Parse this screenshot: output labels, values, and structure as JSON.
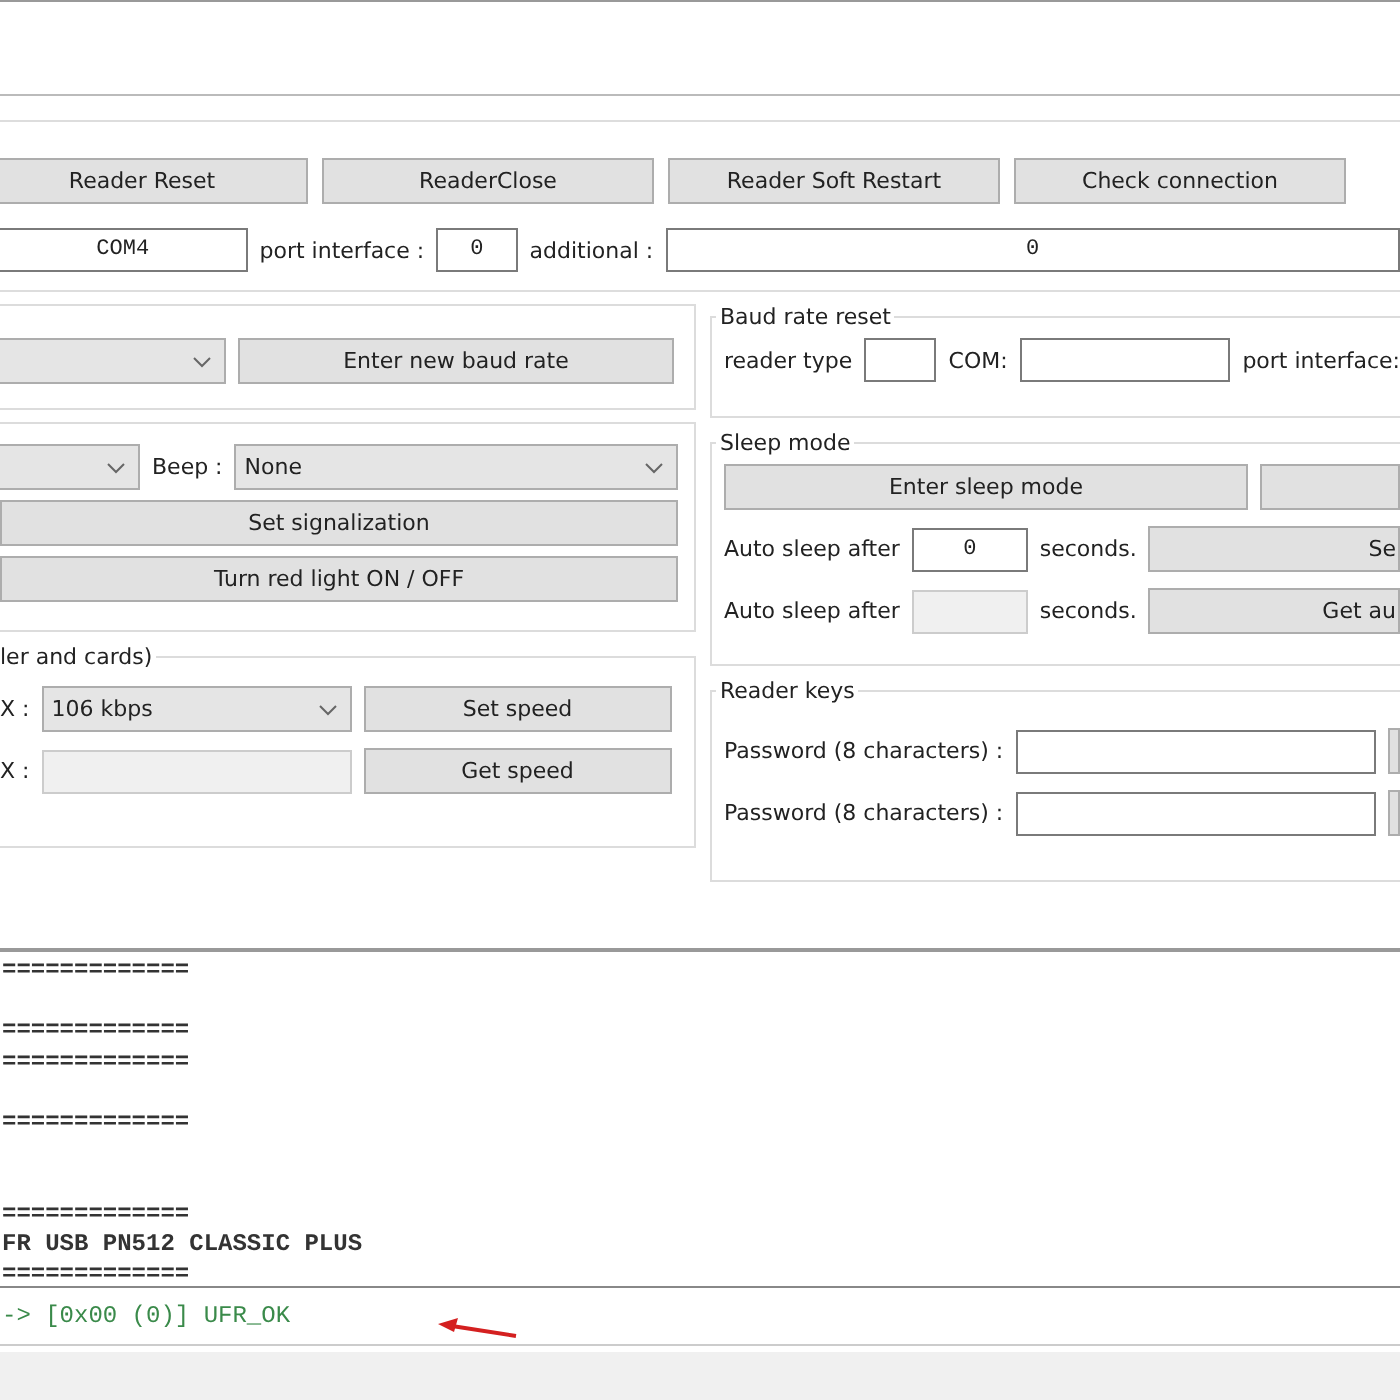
{
  "top_buttons": [
    "Reader Reset",
    "ReaderClose",
    "Reader Soft Restart",
    "Check connection"
  ],
  "connection": {
    "com": "COM4",
    "port_label": "port interface :",
    "port": "0",
    "additional_label": "additional :",
    "additional": "0"
  },
  "baud_panel": {
    "button": "Enter new baud rate"
  },
  "baud_rate_reset": {
    "title": "Baud rate reset",
    "reader_type_label": "reader type",
    "com_label": "COM:",
    "port_label": "port interface:"
  },
  "signalization": {
    "beep_label": "Beep :",
    "beep_value": "None",
    "buttons": [
      "Set signalization",
      "Turn red light ON / OFF"
    ]
  },
  "sleep_mode": {
    "title": "Sleep mode",
    "enter_button": "Enter sleep mode",
    "rows": [
      {
        "label": "Auto sleep after",
        "value": "0",
        "disabled": false,
        "unit": "seconds.",
        "button": "Se"
      },
      {
        "label": "Auto sleep after",
        "value": "",
        "disabled": true,
        "unit": "seconds.",
        "button": "Get au"
      }
    ]
  },
  "speed": {
    "title": "ler and cards)",
    "rows": [
      {
        "kind": "dropdown",
        "label": "X :",
        "value": "106 kbps",
        "button": "Set speed"
      },
      {
        "kind": "readout",
        "label": "X :",
        "value": "",
        "button": "Get speed"
      }
    ]
  },
  "reader_keys": {
    "title": "Reader keys",
    "rows": [
      {
        "label": "Password (8 characters) :"
      },
      {
        "label": "Password (8 characters) :"
      }
    ]
  },
  "log": {
    "lines": [
      {
        "kind": "text",
        "text": "============="
      },
      {
        "kind": "blank"
      },
      {
        "kind": "text",
        "text": "============="
      },
      {
        "kind": "text",
        "text": "============="
      },
      {
        "kind": "blank"
      },
      {
        "kind": "text",
        "text": "============="
      },
      {
        "kind": "blank"
      },
      {
        "kind": "blank"
      },
      {
        "kind": "text",
        "text": "============="
      },
      {
        "kind": "text",
        "text": "FR USB PN512 CLASSIC PLUS"
      },
      {
        "kind": "text",
        "text": "============="
      }
    ]
  },
  "status": {
    "text": "-> [0x00 (0)] UFR_OK"
  }
}
